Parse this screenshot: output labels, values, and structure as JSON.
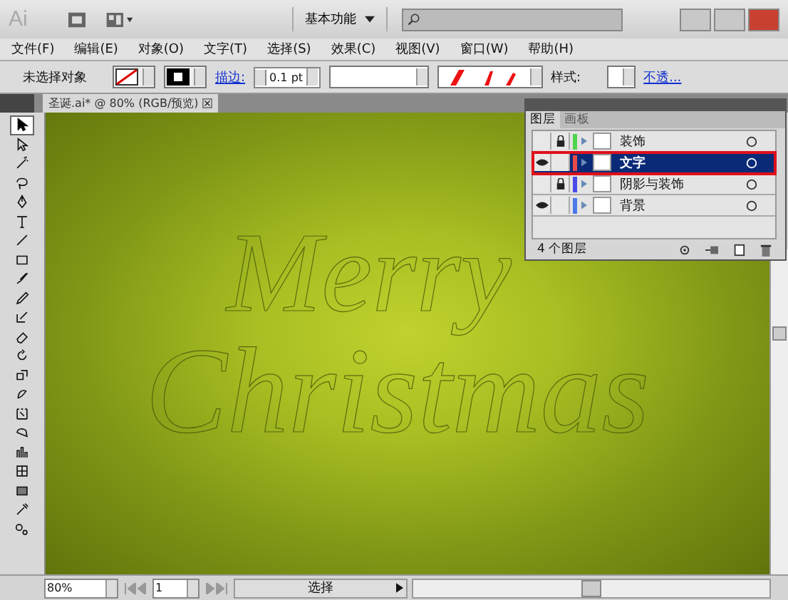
{
  "app_bar": {
    "logo": "Ai",
    "workspace": "基本功能"
  },
  "menu": [
    "文件(F)",
    "编辑(E)",
    "对象(O)",
    "文字(T)",
    "选择(S)",
    "效果(C)",
    "视图(V)",
    "窗口(W)",
    "帮助(H)"
  ],
  "control_bar": {
    "selection": "未选择对象",
    "stroke_label": "描边:",
    "stroke_weight": "0.1 pt",
    "style_label": "样式:",
    "opacity_link": "不透..."
  },
  "document_tab": {
    "title": "圣诞.ai* @ 80% (RGB/预览)"
  },
  "tools": [
    {
      "kind": "select",
      "selected": true
    },
    {
      "kind": "direct",
      "selected": false
    },
    {
      "kind": "wand",
      "selected": false
    },
    {
      "kind": "lasso",
      "selected": false
    },
    {
      "kind": "pen",
      "selected": false
    },
    {
      "kind": "type",
      "selected": false
    },
    {
      "kind": "line",
      "selected": false
    },
    {
      "kind": "rect",
      "selected": false
    },
    {
      "kind": "brush",
      "selected": false
    },
    {
      "kind": "pencil",
      "selected": false
    },
    {
      "kind": "blob",
      "selected": false
    },
    {
      "kind": "eraser",
      "selected": false
    },
    {
      "kind": "rotate",
      "selected": false
    },
    {
      "kind": "scale",
      "selected": false
    },
    {
      "kind": "warp",
      "selected": false
    },
    {
      "kind": "free",
      "selected": false
    },
    {
      "kind": "shape",
      "selected": false
    },
    {
      "kind": "graph",
      "selected": false
    },
    {
      "kind": "mesh",
      "selected": false
    },
    {
      "kind": "gradient",
      "selected": false
    },
    {
      "kind": "eyedropper",
      "selected": false
    },
    {
      "kind": "blend",
      "selected": false
    }
  ],
  "artwork": {
    "line_1": "Merry",
    "line_2": "Christmas"
  },
  "layers_panel": {
    "tabs": [
      {
        "label": "图层",
        "selected": true
      },
      {
        "label": "画板",
        "selected": false
      }
    ],
    "layers": [
      {
        "name": "装饰",
        "visible": false,
        "locked": true,
        "color": "#4fd34f",
        "selected": false
      },
      {
        "name": "文字",
        "visible": true,
        "locked": false,
        "color": "#e84a4a",
        "selected": true
      },
      {
        "name": "阴影与装饰",
        "visible": false,
        "locked": true,
        "color": "#4a4ae8",
        "selected": false
      },
      {
        "name": "背景",
        "visible": true,
        "locked": false,
        "color": "#4a7ae8",
        "selected": false
      }
    ],
    "count": "4 个图层"
  },
  "status_bar": {
    "zoom": "80%",
    "artboard": "1",
    "tool": "选择"
  }
}
